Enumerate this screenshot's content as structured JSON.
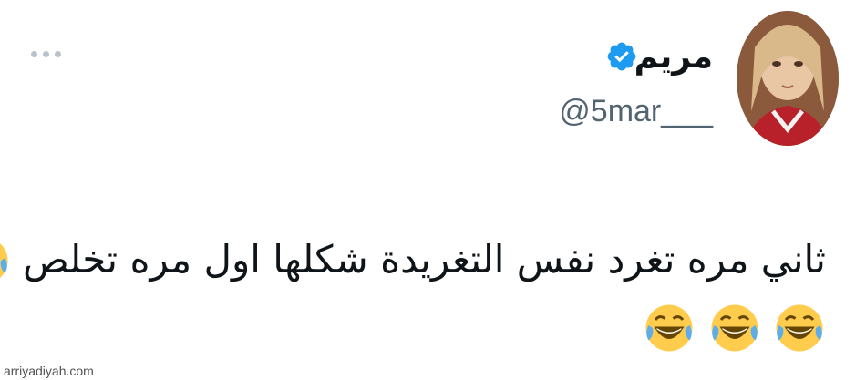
{
  "user": {
    "display_name": "مريم",
    "handle": "@5mar___",
    "verified": true
  },
  "tweet": {
    "text_line1": "ثاني مره تغرد نفس التغريدة شكلها اول مره تخلص",
    "line1_emoji": "face-with-tears-of-joy-icon",
    "line2_emoji_count": 3
  },
  "colors": {
    "text": "#0f1419",
    "secondary": "#536471",
    "verified_blue": "#1d9bf0",
    "background": "#ffffff"
  },
  "icons": [
    "verified-badge-icon",
    "more-options-icon",
    "face-with-tears-of-joy-icon"
  ],
  "watermark": "arriyadiyah.com"
}
